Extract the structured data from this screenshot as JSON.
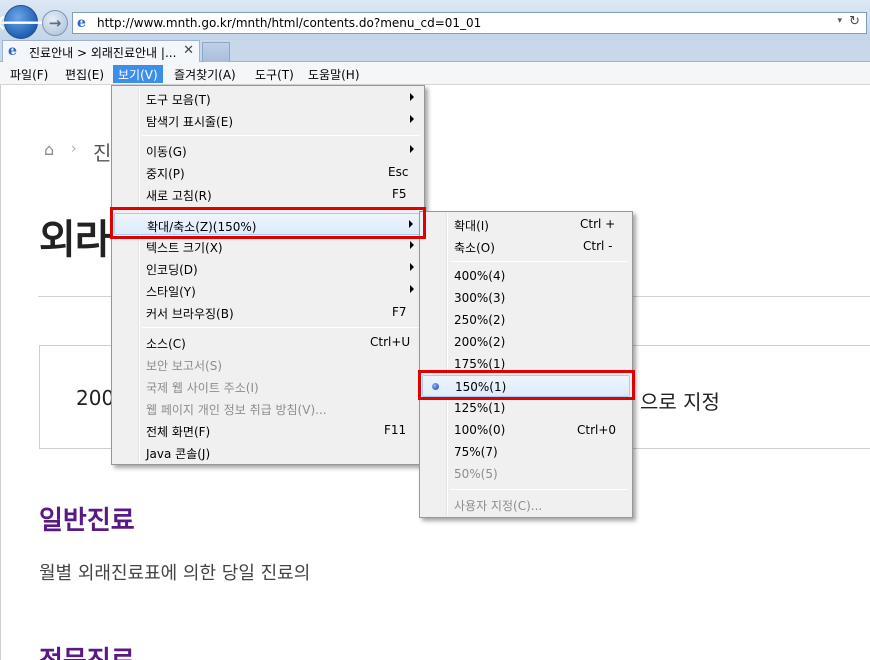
{
  "browser": {
    "url": "http://www.mnth.go.kr/mnth/html/contents.do?menu_cd=01_01",
    "tab_title": "진료안내 > 외래진료안내 |...",
    "back_glyph": "🡐",
    "forward_glyph": "→",
    "ie_glyph": "e",
    "dropdown_glyph": "▾",
    "refresh_glyph": "↻",
    "close_glyph": "✕"
  },
  "menubar": [
    {
      "label": "파일(F)"
    },
    {
      "label": "편집(E)"
    },
    {
      "label": "보기(V)"
    },
    {
      "label": "즐겨찾기(A)"
    },
    {
      "label": "도구(T)"
    },
    {
      "label": "도움말(H)"
    }
  ],
  "view_menu": [
    {
      "label": "도구 모음(T)",
      "submenu": true
    },
    {
      "label": "탐색기 표시줄(E)",
      "submenu": true
    },
    {
      "label": "이동(G)",
      "submenu": true
    },
    {
      "label": "중지(P)",
      "shortcut": "Esc"
    },
    {
      "label": "새로 고침(R)",
      "shortcut": "F5"
    },
    {
      "label": "확대/축소(Z)(150%)",
      "submenu": true
    },
    {
      "label": "텍스트 크기(X)",
      "submenu": true
    },
    {
      "label": "인코딩(D)",
      "submenu": true
    },
    {
      "label": "스타일(Y)",
      "submenu": true
    },
    {
      "label": "커서 브라우징(B)",
      "shortcut": "F7"
    },
    {
      "label": "소스(C)",
      "shortcut": "Ctrl+U"
    },
    {
      "label": "보안 보고서(S)",
      "disabled": true
    },
    {
      "label": "국제 웹 사이트 주소(I)",
      "disabled": true
    },
    {
      "label": "웹 페이지 개인 정보 취급 방침(V)...",
      "disabled": true
    },
    {
      "label": "전체 화면(F)",
      "shortcut": "F11"
    },
    {
      "label": "Java 콘솔(J)"
    }
  ],
  "zoom_menu": [
    {
      "label": "확대(I)",
      "shortcut": "Ctrl +"
    },
    {
      "label": "축소(O)",
      "shortcut": "Ctrl -"
    },
    {
      "label": "400%(4)"
    },
    {
      "label": "300%(3)"
    },
    {
      "label": "250%(2)"
    },
    {
      "label": "200%(2)"
    },
    {
      "label": "175%(1)"
    },
    {
      "label": "150%(1)",
      "selected": true
    },
    {
      "label": "125%(1)"
    },
    {
      "label": "100%(0)",
      "shortcut": "Ctrl+0"
    },
    {
      "label": "75%(7)"
    },
    {
      "label": "50%(5)",
      "disabled": true
    },
    {
      "label": "사용자 지정(C)...",
      "disabled": true
    }
  ],
  "page": {
    "home_glyph": "⌂",
    "breadcrumb_sep": "›",
    "breadcrumb": "진",
    "title": "외라",
    "info_left": "200",
    "info_right": "으로 지정",
    "section1_title": "일반진료",
    "section1_body": "월별 외래진료표에 의한 당일 진료의",
    "section2_title": "전문진료"
  }
}
